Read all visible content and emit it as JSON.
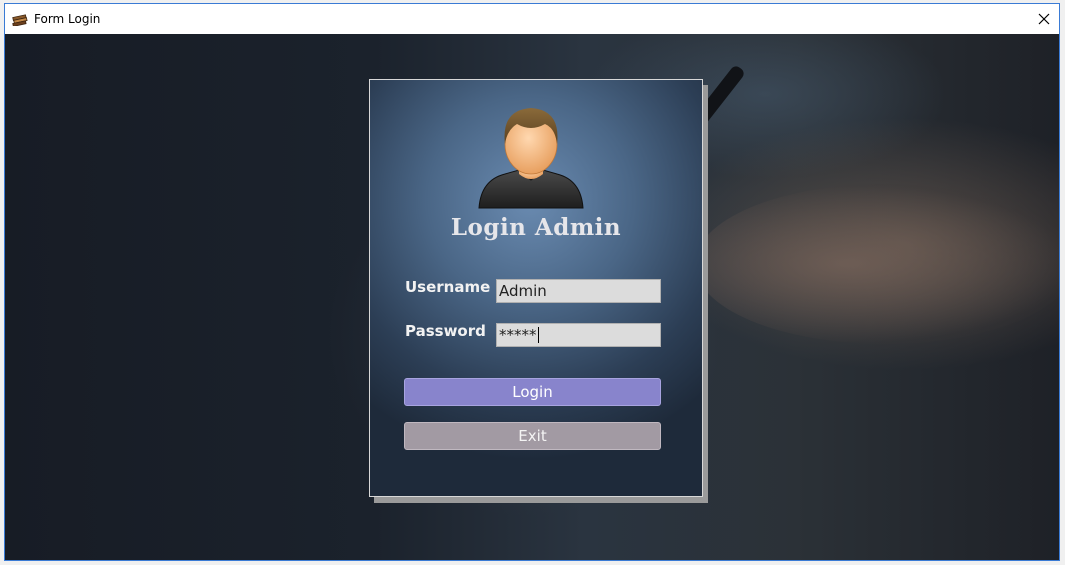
{
  "window": {
    "title": "Form Login",
    "icon": "books-icon",
    "close_icon": "close-icon"
  },
  "login_panel": {
    "heading": "Login Admin",
    "avatar_icon": "user-avatar-icon",
    "username": {
      "label": "Username",
      "value": "Admin"
    },
    "password": {
      "label": "Password",
      "value": "*****"
    },
    "login_button": "Login",
    "exit_button": "Exit"
  },
  "colors": {
    "login_button": "#8884cc",
    "exit_button": "#a29aa3",
    "panel_center": "#6a8bb1",
    "panel_edge": "#1e2a3a"
  }
}
